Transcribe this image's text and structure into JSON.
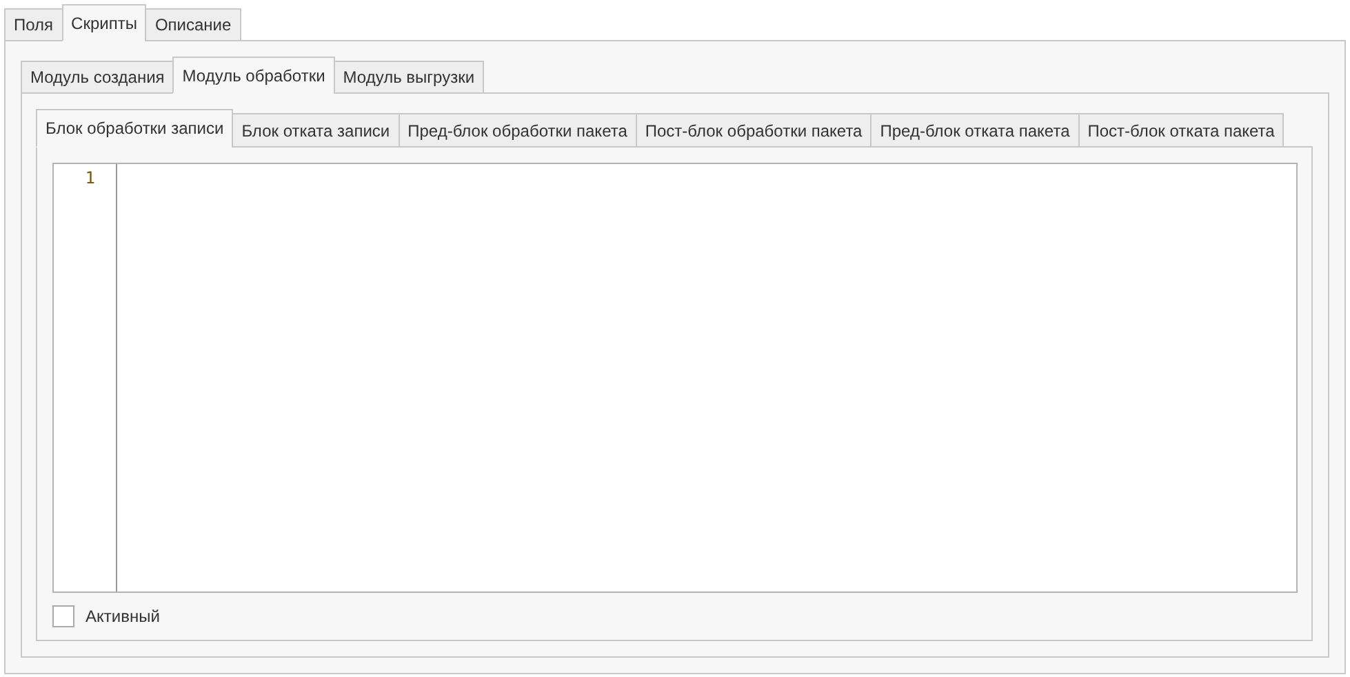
{
  "main_tabs": [
    {
      "label": "Поля",
      "selected": false
    },
    {
      "label": "Скрипты",
      "selected": true
    },
    {
      "label": "Описание",
      "selected": false
    }
  ],
  "module_tabs": [
    {
      "label": "Модуль создания",
      "selected": false
    },
    {
      "label": "Модуль обработки",
      "selected": true
    },
    {
      "label": "Модуль выгрузки",
      "selected": false
    }
  ],
  "block_tabs": [
    {
      "label": "Блок обработки записи",
      "selected": true
    },
    {
      "label": "Блок отката записи",
      "selected": false
    },
    {
      "label": "Пред-блок обработки пакета",
      "selected": false
    },
    {
      "label": "Пост-блок обработки пакета",
      "selected": false
    },
    {
      "label": "Пред-блок отката пакета",
      "selected": false
    },
    {
      "label": "Пост-блок отката пакета",
      "selected": false
    }
  ],
  "editor": {
    "line_numbers": [
      "1"
    ]
  },
  "active_checkbox": {
    "label": "Активный",
    "checked": false
  }
}
